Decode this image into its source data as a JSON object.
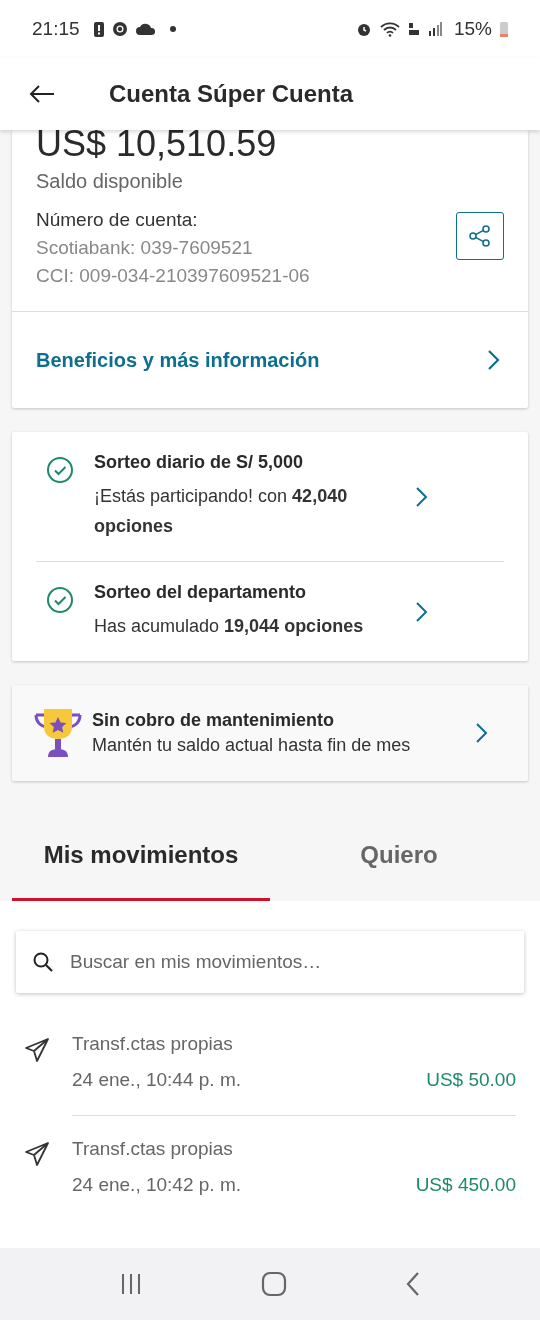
{
  "status_bar": {
    "time": "21:15",
    "battery": "15%"
  },
  "header": {
    "title": "Cuenta Súper Cuenta"
  },
  "account": {
    "balance": "US$ 10,510.59",
    "balance_label": "Saldo disponible",
    "number_label": "Número de cuenta:",
    "bank_number": "Scotiabank: 039-7609521",
    "cci": "CCI: 009-034-210397609521-06",
    "link": "Beneficios y más información"
  },
  "raffles": [
    {
      "title": "Sorteo diario de S/ 5,000",
      "text": "¡Estás participando! con **42,040 opciones**"
    },
    {
      "title": "Sorteo del departamento",
      "text": "Has acumulado  **19,044 opciones**"
    }
  ],
  "promo": {
    "title": "Sin cobro de mantenimiento",
    "text": "Mantén tu saldo actual hasta fin de mes"
  },
  "tabs": [
    {
      "label": "Mis movimientos",
      "selected": true
    },
    {
      "label": "Quiero",
      "selected": false
    }
  ],
  "search": {
    "placeholder": "Buscar en mis movimientos…"
  },
  "movements": [
    {
      "title": "Transf.ctas propias",
      "date": "24 ene., 10:44 p. m.",
      "amount": "US$ 50.00"
    },
    {
      "title": "Transf.ctas propias",
      "date": "24 ene., 10:42 p. m.",
      "amount": "US$ 450.00"
    }
  ]
}
